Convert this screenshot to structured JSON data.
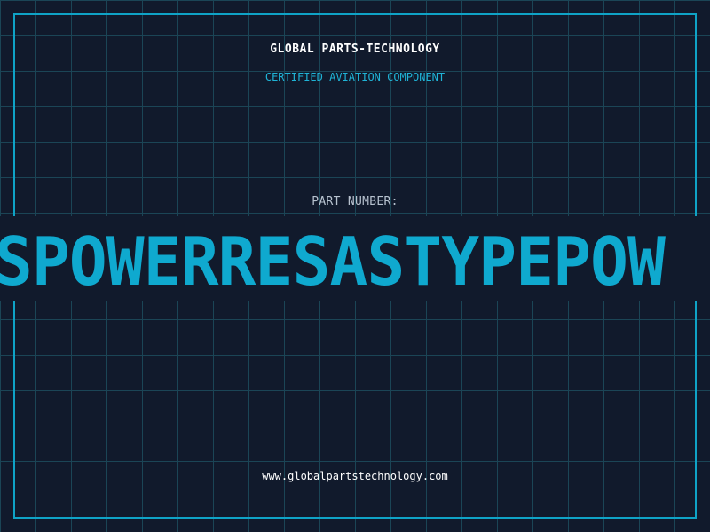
{
  "header": {
    "company": "GLOBAL PARTS-TECHNOLOGY",
    "subtitle": "CERTIFIED AVIATION COMPONENT"
  },
  "part": {
    "label": "PART NUMBER:",
    "number": "SPOWERRESASTYPEPOW"
  },
  "footer": {
    "website": "www.globalpartstechnology.com"
  },
  "colors": {
    "background": "#111a2c",
    "grid": "#1b4556",
    "accent": "#0fa9cf",
    "text": "#ffffff"
  }
}
